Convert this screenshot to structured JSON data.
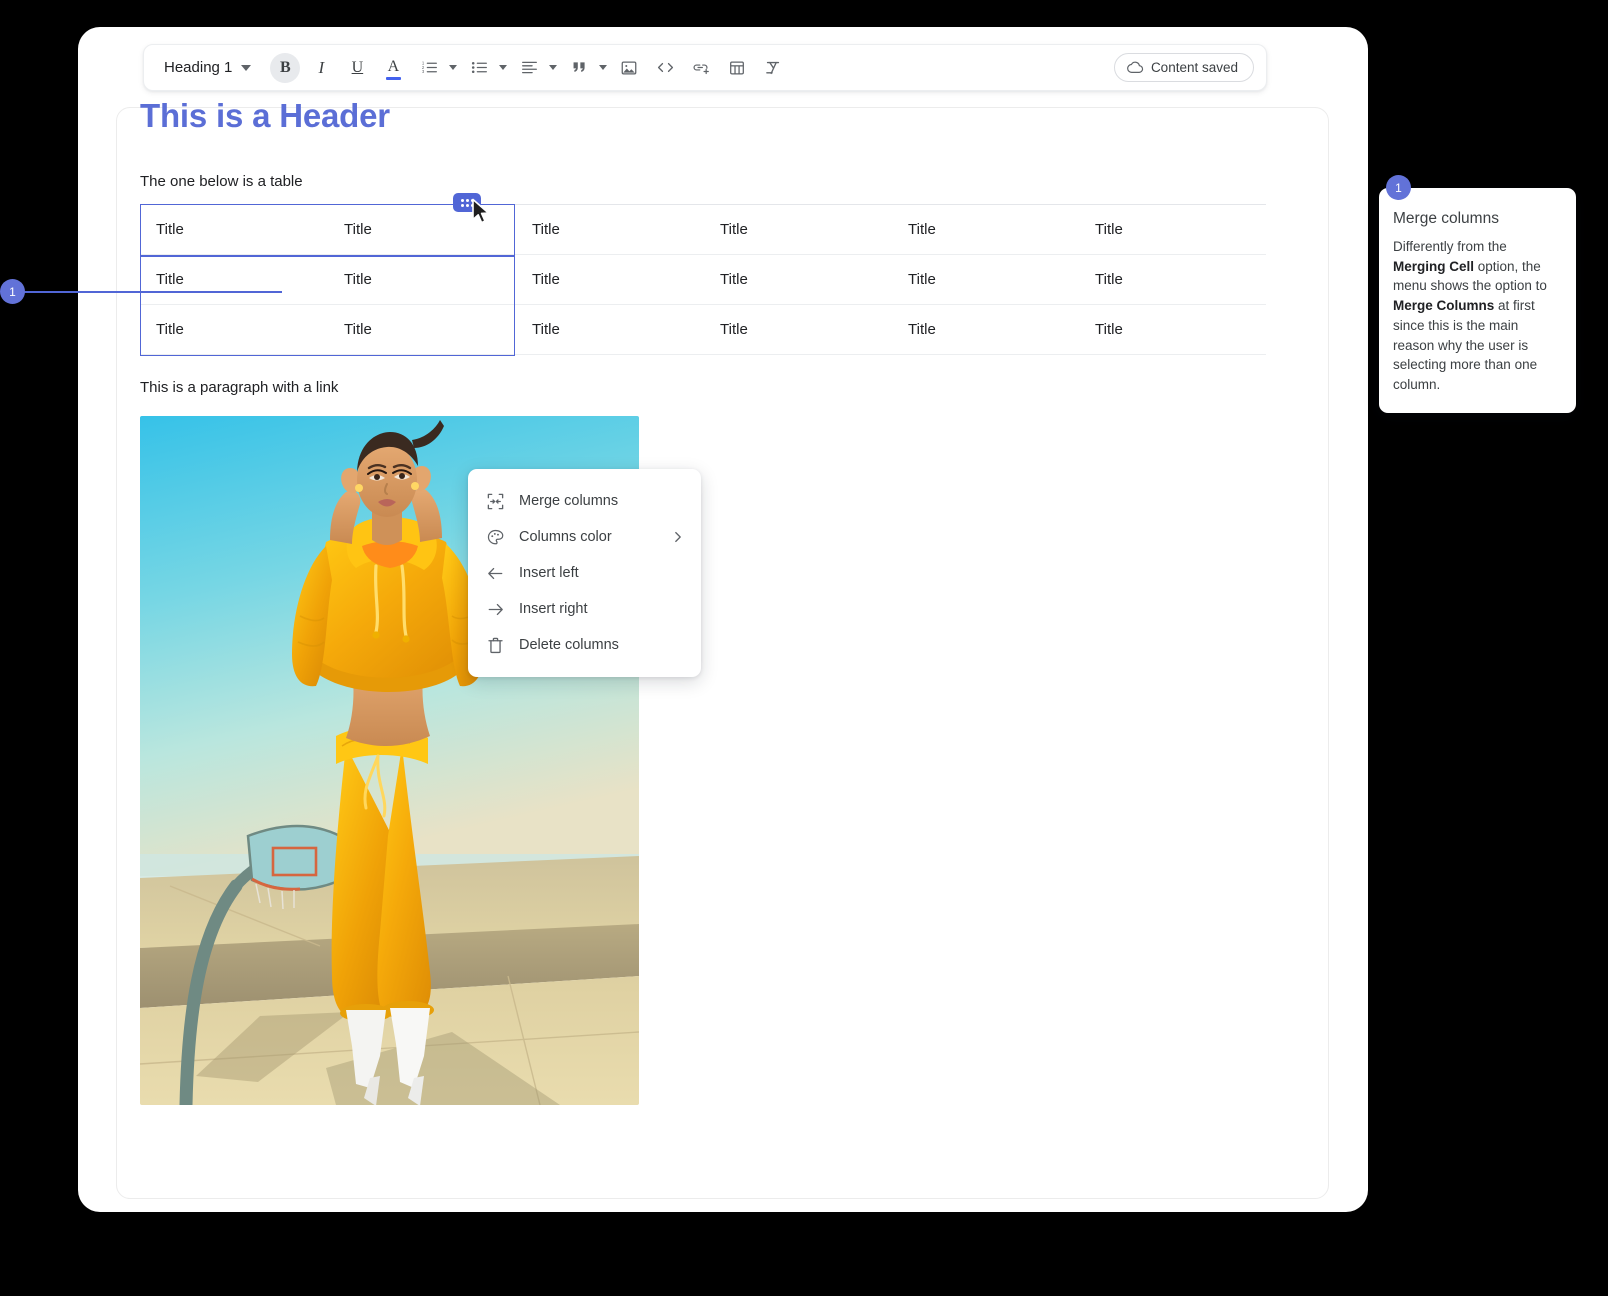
{
  "toolbar": {
    "style_select": "Heading 1",
    "bold_label": "B",
    "italic_label": "I",
    "underline_label": "U",
    "text_color_label": "A",
    "saved_label": "Content saved",
    "icons": [
      "heading-select",
      "bold-icon",
      "italic-icon",
      "underline-icon",
      "text-color-icon",
      "numbered-list-icon",
      "bullet-list-icon",
      "align-left-icon",
      "blockquote-icon",
      "image-icon",
      "code-icon",
      "link-icon",
      "table-icon",
      "clear-format-icon",
      "cloud-saved-icon"
    ],
    "accent_color": "#4361ee"
  },
  "document": {
    "heading": "This is a Header",
    "heading_color": "#5b6ed6",
    "intro_paragraph": "The one below is a table",
    "link_paragraph": "This is a paragraph with a link",
    "figure_alt": "Woman in yellow tracksuit standing on concrete court near a basketball hoop"
  },
  "table": {
    "columns": 6,
    "rows": [
      [
        "Title",
        "Title",
        "Title",
        "Title",
        "Title",
        "Title"
      ],
      [
        "Title",
        "Title",
        "Title",
        "Title",
        "Title",
        "Title"
      ],
      [
        "Title",
        "Title",
        "Title",
        "Title",
        "Title",
        "Title"
      ]
    ],
    "selection": {
      "selected_columns": 2,
      "selection_color": "#5166d6",
      "grip_label": "column-grip-handle"
    }
  },
  "context_menu": {
    "items": [
      {
        "label": "Merge columns",
        "icon": "merge-columns-icon",
        "has_submenu": false
      },
      {
        "label": "Columns color",
        "icon": "palette-icon",
        "has_submenu": true
      },
      {
        "label": "Insert left",
        "icon": "arrow-left-icon",
        "has_submenu": false
      },
      {
        "label": "Insert right",
        "icon": "arrow-right-icon",
        "has_submenu": false
      },
      {
        "label": "Delete columns",
        "icon": "trash-icon",
        "has_submenu": false
      }
    ]
  },
  "annotation": {
    "number": "1",
    "marker_color": "#6272d8",
    "title": "Merge columns",
    "body_segments": [
      {
        "text": "Differently from the ",
        "bold": false
      },
      {
        "text": "Merging Cell",
        "bold": true
      },
      {
        "text": " option, the menu shows the option to ",
        "bold": false
      },
      {
        "text": "Merge Columns",
        "bold": true
      },
      {
        "text": " at first since this is the main reason why the user is selecting more than one column.",
        "bold": false
      }
    ]
  }
}
